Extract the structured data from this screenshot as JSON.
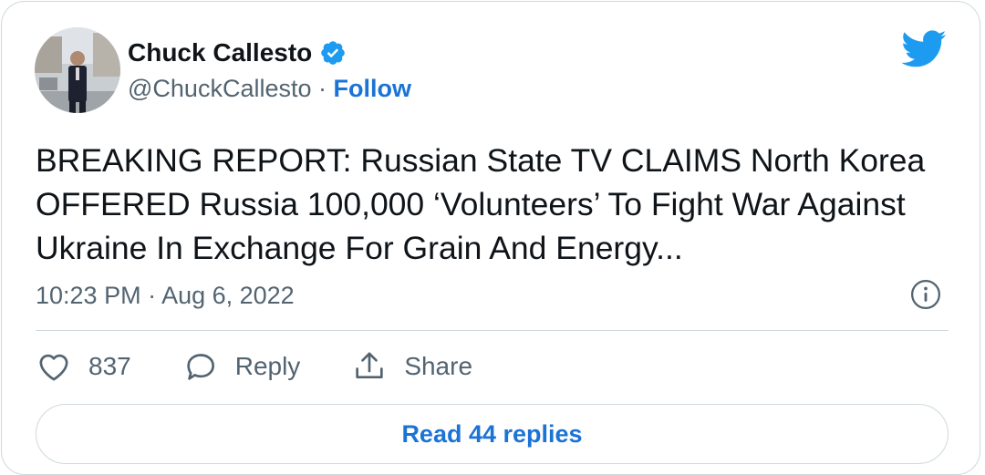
{
  "author": {
    "name": "Chuck Callesto",
    "handle": "@ChuckCallesto",
    "separator": "·",
    "follow_label": "Follow"
  },
  "tweet": {
    "text": "BREAKING REPORT: Russian State TV CLAIMS North Korea\nOFFERED Russia 100,000 ‘Volunteers’ To Fight War Against\nUkraine In Exchange For Grain And Energy...",
    "timestamp": "10:23 PM · Aug 6, 2022"
  },
  "actions": {
    "likes_count": "837",
    "reply_label": "Reply",
    "share_label": "Share"
  },
  "read_replies_label": "Read 44 replies",
  "icons": {
    "brand": "twitter-bird-icon",
    "verified": "verified-badge-icon",
    "info": "info-icon",
    "like": "heart-icon",
    "reply": "reply-bubble-icon",
    "share": "share-icon"
  },
  "colors": {
    "accent": "#1d9bf0",
    "link": "#1b73d6",
    "text": "#0f1419",
    "secondary": "#536471",
    "border": "#cfd9de"
  }
}
